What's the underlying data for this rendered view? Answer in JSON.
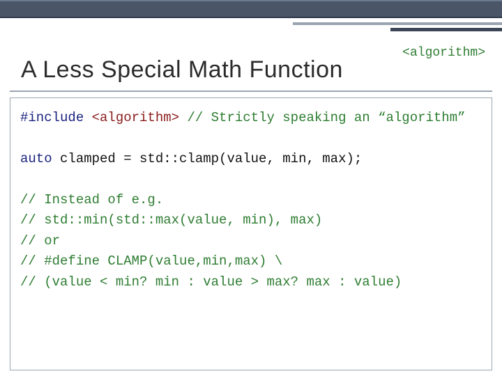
{
  "header": {
    "title": "A Less Special Math Function",
    "tag": "<algorithm>"
  },
  "code": {
    "l1_pre": "#include",
    "l1_hdr": " <algorithm>",
    "l1_cmt": "  // Strictly speaking an “algorithm”",
    "l3_kw": "auto",
    "l3_rest": " clamped = std::clamp(value, min, max);",
    "c1": "// Instead of e.g.",
    "c2": "//    std::min(std::max(value, min), max)",
    "c3": "// or",
    "c4": "//    #define CLAMP(value,min,max) \\",
    "c5": "//      (value < min? min : value > max? max : value)"
  }
}
